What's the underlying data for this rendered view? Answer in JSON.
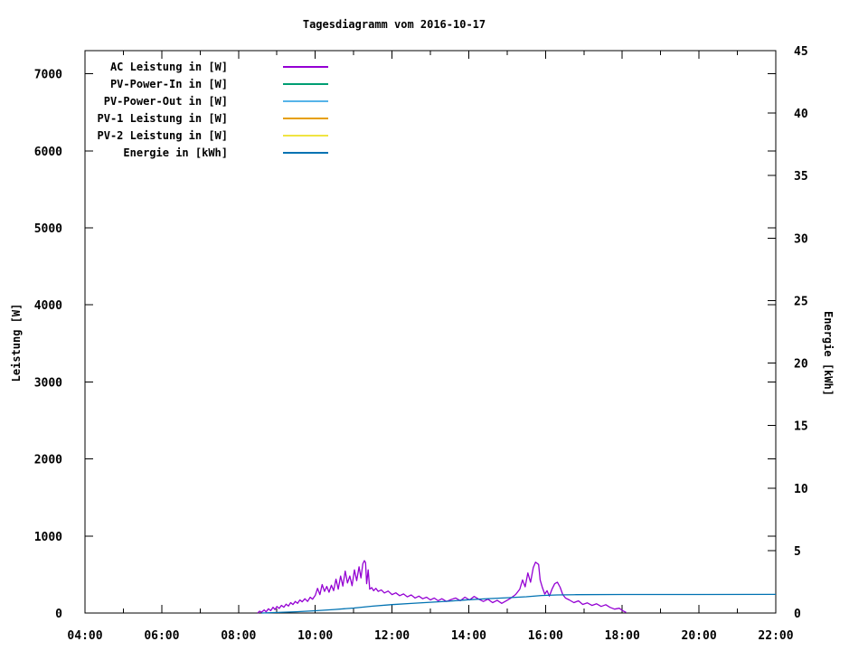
{
  "title": "Tagesdiagramm vom 2016-10-17",
  "colors": {
    "background": "#ffffff",
    "foreground": "#000000",
    "ac_leistung": "#9400d3",
    "pv_power_in": "#009e73",
    "pv_power_out": "#56b4e9",
    "pv1_leistung": "#e69f00",
    "pv2_leistung": "#f0e442",
    "energie": "#0072b2"
  },
  "legend": [
    {
      "label": "AC Leistung in [W]",
      "color": "#9400d3"
    },
    {
      "label": "PV-Power-In in [W]",
      "color": "#009e73"
    },
    {
      "label": "PV-Power-Out in [W]",
      "color": "#56b4e9"
    },
    {
      "label": "PV-1 Leistung in [W]",
      "color": "#e69f00"
    },
    {
      "label": "PV-2 Leistung in [W]",
      "color": "#f0e442"
    },
    {
      "label": "Energie in [kWh]",
      "color": "#0072b2"
    }
  ],
  "chart_data": {
    "type": "line",
    "title": "Tagesdiagramm vom 2016-10-17",
    "grid": false,
    "legend_position": "top-left-inside",
    "x_axis": {
      "unit": "time of day",
      "range_hours": [
        4,
        22
      ],
      "major_hours": [
        4,
        6,
        8,
        10,
        12,
        14,
        16,
        18,
        20,
        22
      ],
      "major_labels": [
        "04:00",
        "06:00",
        "08:00",
        "10:00",
        "12:00",
        "14:00",
        "16:00",
        "18:00",
        "20:00",
        "22:00"
      ],
      "minor_hours": [
        5,
        7,
        9,
        11,
        13,
        15,
        17,
        19,
        21
      ]
    },
    "y_axis_left": {
      "label": "Leistung [W]",
      "range": [
        0,
        7300
      ],
      "tick_values": [
        0,
        1000,
        2000,
        3000,
        4000,
        5000,
        6000,
        7000
      ]
    },
    "y_axis_right": {
      "label": "Energie [kWh]",
      "range": [
        0,
        45
      ],
      "tick_values": [
        0,
        5,
        10,
        15,
        20,
        25,
        30,
        35,
        40,
        45
      ]
    },
    "series": [
      {
        "name": "AC Leistung in [W]",
        "color": "#9400d3",
        "axis": "left",
        "points": [
          [
            8.5,
            0
          ],
          [
            8.55,
            25
          ],
          [
            8.6,
            10
          ],
          [
            8.67,
            40
          ],
          [
            8.72,
            15
          ],
          [
            8.78,
            55
          ],
          [
            8.84,
            30
          ],
          [
            8.9,
            75
          ],
          [
            8.95,
            45
          ],
          [
            9.0,
            85
          ],
          [
            9.06,
            60
          ],
          [
            9.12,
            100
          ],
          [
            9.18,
            75
          ],
          [
            9.24,
            115
          ],
          [
            9.3,
            90
          ],
          [
            9.36,
            135
          ],
          [
            9.42,
            110
          ],
          [
            9.48,
            150
          ],
          [
            9.54,
            125
          ],
          [
            9.6,
            170
          ],
          [
            9.66,
            145
          ],
          [
            9.73,
            185
          ],
          [
            9.8,
            150
          ],
          [
            9.87,
            205
          ],
          [
            9.93,
            180
          ],
          [
            10.0,
            230
          ],
          [
            10.06,
            320
          ],
          [
            10.12,
            240
          ],
          [
            10.18,
            370
          ],
          [
            10.24,
            280
          ],
          [
            10.3,
            345
          ],
          [
            10.36,
            270
          ],
          [
            10.42,
            360
          ],
          [
            10.48,
            290
          ],
          [
            10.54,
            440
          ],
          [
            10.6,
            310
          ],
          [
            10.66,
            480
          ],
          [
            10.72,
            350
          ],
          [
            10.78,
            545
          ],
          [
            10.84,
            390
          ],
          [
            10.9,
            480
          ],
          [
            10.96,
            355
          ],
          [
            11.02,
            560
          ],
          [
            11.08,
            420
          ],
          [
            11.14,
            600
          ],
          [
            11.19,
            455
          ],
          [
            11.24,
            640
          ],
          [
            11.28,
            680
          ],
          [
            11.31,
            655
          ],
          [
            11.34,
            380
          ],
          [
            11.38,
            560
          ],
          [
            11.42,
            310
          ],
          [
            11.47,
            330
          ],
          [
            11.52,
            290
          ],
          [
            11.58,
            320
          ],
          [
            11.64,
            280
          ],
          [
            11.72,
            300
          ],
          [
            11.8,
            260
          ],
          [
            11.9,
            285
          ],
          [
            12.0,
            240
          ],
          [
            12.1,
            262
          ],
          [
            12.2,
            225
          ],
          [
            12.3,
            248
          ],
          [
            12.4,
            210
          ],
          [
            12.5,
            235
          ],
          [
            12.6,
            195
          ],
          [
            12.7,
            220
          ],
          [
            12.8,
            185
          ],
          [
            12.9,
            205
          ],
          [
            13.0,
            170
          ],
          [
            13.1,
            195
          ],
          [
            13.2,
            160
          ],
          [
            13.3,
            185
          ],
          [
            13.42,
            150
          ],
          [
            13.54,
            175
          ],
          [
            13.66,
            195
          ],
          [
            13.78,
            160
          ],
          [
            13.9,
            205
          ],
          [
            14.02,
            170
          ],
          [
            14.14,
            215
          ],
          [
            14.26,
            180
          ],
          [
            14.38,
            150
          ],
          [
            14.5,
            180
          ],
          [
            14.62,
            135
          ],
          [
            14.74,
            165
          ],
          [
            14.86,
            125
          ],
          [
            14.98,
            160
          ],
          [
            15.1,
            195
          ],
          [
            15.22,
            240
          ],
          [
            15.33,
            310
          ],
          [
            15.4,
            430
          ],
          [
            15.47,
            340
          ],
          [
            15.54,
            520
          ],
          [
            15.61,
            400
          ],
          [
            15.68,
            590
          ],
          [
            15.74,
            660
          ],
          [
            15.78,
            645
          ],
          [
            15.82,
            630
          ],
          [
            15.86,
            430
          ],
          [
            15.92,
            330
          ],
          [
            15.98,
            245
          ],
          [
            16.04,
            290
          ],
          [
            16.1,
            220
          ],
          [
            16.17,
            310
          ],
          [
            16.24,
            380
          ],
          [
            16.31,
            400
          ],
          [
            16.38,
            335
          ],
          [
            16.45,
            240
          ],
          [
            16.52,
            195
          ],
          [
            16.62,
            170
          ],
          [
            16.74,
            135
          ],
          [
            16.86,
            158
          ],
          [
            16.97,
            112
          ],
          [
            17.09,
            132
          ],
          [
            17.21,
            98
          ],
          [
            17.33,
            120
          ],
          [
            17.45,
            86
          ],
          [
            17.57,
            108
          ],
          [
            17.68,
            74
          ],
          [
            17.8,
            50
          ],
          [
            17.92,
            62
          ],
          [
            18.03,
            25
          ],
          [
            18.1,
            8
          ]
        ]
      },
      {
        "name": "PV-Power-In in [W]",
        "color": "#009e73",
        "axis": "left",
        "points": []
      },
      {
        "name": "PV-Power-Out in [W]",
        "color": "#56b4e9",
        "axis": "left",
        "points": []
      },
      {
        "name": "PV-1 Leistung in [W]",
        "color": "#e69f00",
        "axis": "left",
        "points": []
      },
      {
        "name": "PV-2 Leistung in [W]",
        "color": "#f0e442",
        "axis": "left",
        "points": []
      },
      {
        "name": "Energie in [kWh]",
        "color": "#0072b2",
        "axis": "right",
        "points": [
          [
            8.6,
            0
          ],
          [
            9.0,
            0.04
          ],
          [
            9.5,
            0.1
          ],
          [
            10.0,
            0.18
          ],
          [
            10.5,
            0.28
          ],
          [
            11.0,
            0.4
          ],
          [
            11.5,
            0.55
          ],
          [
            12.0,
            0.67
          ],
          [
            12.5,
            0.77
          ],
          [
            13.0,
            0.86
          ],
          [
            13.5,
            0.95
          ],
          [
            14.0,
            1.06
          ],
          [
            14.5,
            1.15
          ],
          [
            15.0,
            1.22
          ],
          [
            15.5,
            1.3
          ],
          [
            15.9,
            1.4
          ],
          [
            16.3,
            1.45
          ],
          [
            16.8,
            1.47
          ],
          [
            18.0,
            1.48
          ],
          [
            20.0,
            1.48
          ],
          [
            22.0,
            1.49
          ]
        ]
      }
    ]
  }
}
